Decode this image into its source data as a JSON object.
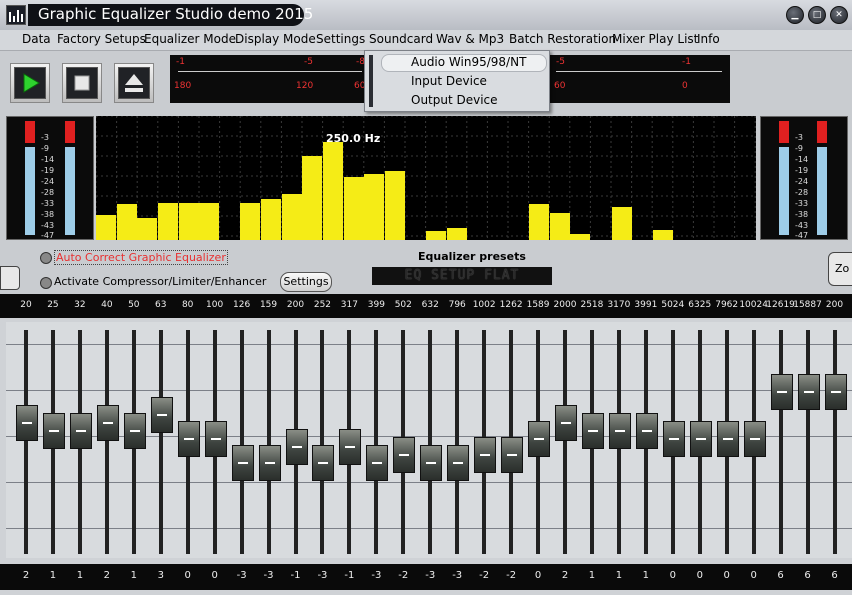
{
  "window": {
    "title": "Graphic Equalizer Studio demo 2015"
  },
  "menu": [
    "Data",
    "Factory Setups",
    "Equalizer Mode",
    "Display Mode",
    "Settings",
    "Soundcard",
    "Wav & Mp3",
    "Batch Restoration",
    "Mixer Play List",
    "Info"
  ],
  "soundcard_menu": {
    "items": [
      "Audio Win95/98/NT",
      "Input Device",
      "Output Device"
    ],
    "highlighted": 0
  },
  "meters": {
    "left_scale": [
      "-1",
      "-5",
      "-8"
    ],
    "left_numbers": [
      "180",
      "120",
      "60"
    ],
    "right_scale": [
      "-5",
      "-1"
    ],
    "right_numbers": [
      "60",
      "0"
    ],
    "side_ticks": [
      "-3",
      "-9",
      "-14",
      "-19",
      "-24",
      "-28",
      "-33",
      "-38",
      "-43",
      "-47"
    ]
  },
  "spectrum": {
    "peak_label": "250.0 Hz",
    "levels": [
      0.2,
      0.29,
      0.18,
      0.3,
      0.3,
      0.3,
      0,
      0.3,
      0.33,
      0.37,
      0.68,
      0.79,
      0.51,
      0.53,
      0.56,
      0,
      0.07,
      0.1,
      0,
      0,
      0,
      0.29,
      0.22,
      0.05,
      0,
      0.27,
      0,
      0.08,
      0,
      0,
      0,
      0
    ]
  },
  "controls": {
    "auto_correct": "Auto Correct Graphic Equalizer",
    "activate": "Activate Compressor/Limiter/Enhancer",
    "settings_button": "Settings",
    "presets_label": "Equalizer presets",
    "preset_display": "EQ SETUP FLAT",
    "zoom_label": "Zo"
  },
  "equalizer": {
    "frequencies": [
      "20",
      "25",
      "32",
      "40",
      "50",
      "63",
      "80",
      "100",
      "126",
      "159",
      "200",
      "252",
      "317",
      "399",
      "502",
      "632",
      "796",
      "1002",
      "1262",
      "1589",
      "2000",
      "2518",
      "3170",
      "3991",
      "5024",
      "6325",
      "7962",
      "10024",
      "12619",
      "15887",
      "200"
    ],
    "values": [
      2,
      1,
      1,
      2,
      1,
      3,
      0,
      0,
      -3,
      -3,
      -1,
      -3,
      -1,
      -3,
      -2,
      -3,
      -3,
      -2,
      -2,
      0,
      2,
      1,
      1,
      1,
      0,
      0,
      0,
      0,
      6,
      6,
      6
    ],
    "range": [
      -12,
      12
    ]
  }
}
